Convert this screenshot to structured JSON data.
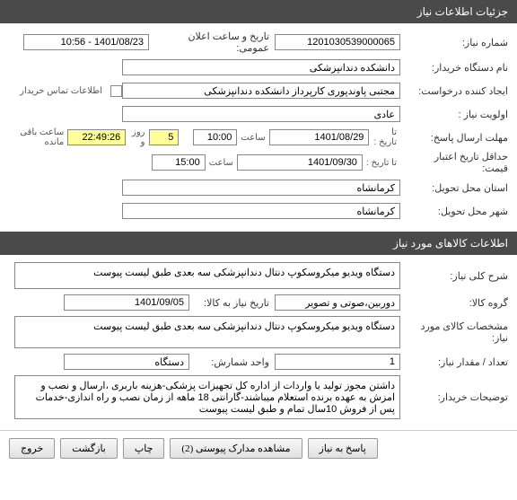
{
  "header": {
    "title": "جزئیات اطلاعات نیاز"
  },
  "general": {
    "need_no_label": "شماره نیاز:",
    "need_no": "1201030539000065",
    "public_date_label": "تاریخ و ساعت اعلان عمومی:",
    "public_date": "1401/08/23 - 10:56",
    "buyer_label": "نام دستگاه خریدار:",
    "buyer": "دانشکده دندانپزشکی",
    "requester_label": "ایجاد کننده درخواست:",
    "requester": "مجتبی  پاوندپوری کارپرداز دانشکده دندانپزشکی",
    "buyer_contact_chk": "اطلاعات تماس خریدار",
    "priority_label": "اولویت نیاز :",
    "priority": "عادی",
    "deadline_label": "مهلت ارسال پاسخ:",
    "to_date_label": "تا تاریخ :",
    "deadline_date": "1401/08/29",
    "time_label": "ساعت",
    "deadline_time": "10:00",
    "days_count": "5",
    "days_and": "روز و",
    "countdown": "22:49:26",
    "remaining": "ساعت باقی مانده",
    "validity_label": "حداقل تاریخ اعتبار قیمت:",
    "validity_to_date": "تا تاریخ :",
    "validity_date": "1401/09/30",
    "validity_time": "15:00",
    "province_label": "استان محل تحویل:",
    "province": "کرمانشاه",
    "city_label": "شهر محل تحویل:",
    "city": "کرمانشاه"
  },
  "goods_header": {
    "title": "اطلاعات کالاهای مورد نیاز"
  },
  "goods": {
    "desc_label": "شرح کلی نیاز:",
    "desc": "دستگاه ویدیو میکروسکوپ دنتال  دندانپزشکی سه بعدی طبق لیست پیوست",
    "group_label": "گروه کالا:",
    "group": "دوربین،صوتی و تصویر",
    "need_to_date_label": "تاریخ نیاز به کالا:",
    "need_to_date": "1401/09/05",
    "spec_label": "مشخصات کالای مورد نیاز:",
    "spec": "دستگاه ویدیو میکروسکوپ دنتال  دندانپزشکی سه بعدی طبق لیست پیوست",
    "qty_label": "تعداد / مقدار نیاز:",
    "qty": "1",
    "unit_label": "واحد شمارش:",
    "unit": "دستگاه",
    "buyer_notes_label": "توضیحات خریدار:",
    "buyer_notes": "داشتن مجوز تولید یا واردات از اداره کل تجهیزات پزشکی-هزینه باربری ،ارسال و نصب و امزش به عهده برنده استعلام میباشند-گارانتی 18 ماهه از زمان نصب و راه اندازی-خدمات پس از فروش 10سال تمام و طبق لیست پیوست"
  },
  "buttons": {
    "respond": "پاسخ به نیاز",
    "attachments": "مشاهده مدارک پیوستی (2)",
    "print": "چاپ",
    "back": "بازگشت",
    "exit": "خروج"
  }
}
